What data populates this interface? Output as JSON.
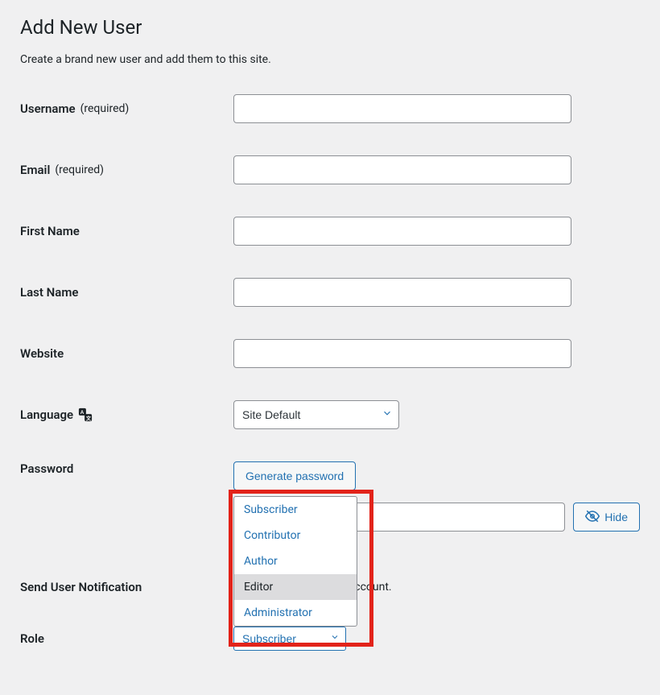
{
  "page": {
    "title": "Add New User",
    "subtitle": "Create a brand new user and add them to this site."
  },
  "fields": {
    "username": {
      "label": "Username",
      "required": "(required)",
      "value": ""
    },
    "email": {
      "label": "Email",
      "required": "(required)",
      "value": ""
    },
    "first_name": {
      "label": "First Name",
      "value": ""
    },
    "last_name": {
      "label": "Last Name",
      "value": ""
    },
    "website": {
      "label": "Website",
      "value": ""
    },
    "language": {
      "label": "Language",
      "value": "Site Default"
    },
    "password": {
      "label": "Password",
      "generate_btn": "Generate password",
      "hide_btn": "Hide",
      "value": ""
    },
    "notification": {
      "label": "Send User Notification",
      "text": "er an email about their account."
    },
    "role": {
      "label": "Role",
      "value": "Subscriber"
    }
  },
  "role_options": [
    "Subscriber",
    "Contributor",
    "Author",
    "Editor",
    "Administrator"
  ],
  "highlighted_option_index": 3
}
